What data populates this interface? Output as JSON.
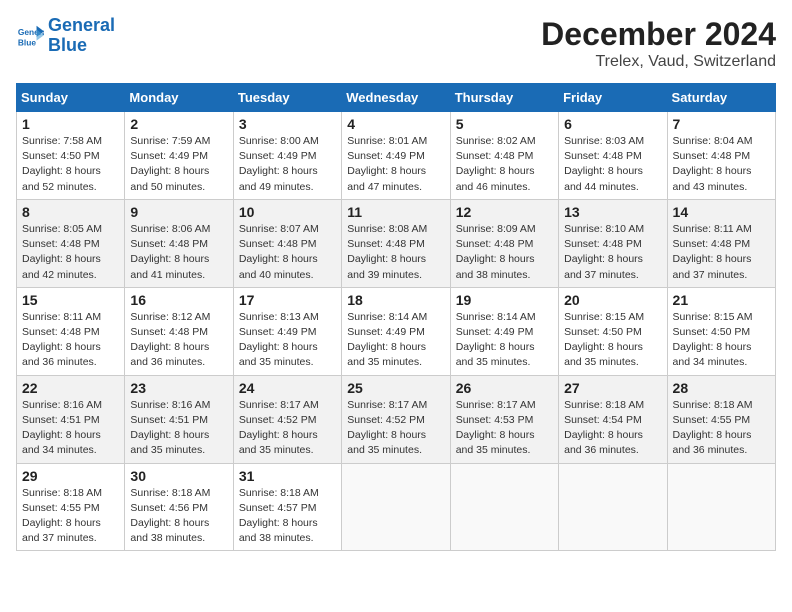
{
  "header": {
    "logo_line1": "General",
    "logo_line2": "Blue",
    "title": "December 2024",
    "subtitle": "Trelex, Vaud, Switzerland"
  },
  "columns": [
    "Sunday",
    "Monday",
    "Tuesday",
    "Wednesday",
    "Thursday",
    "Friday",
    "Saturday"
  ],
  "weeks": [
    [
      {
        "day": "1",
        "detail": "Sunrise: 7:58 AM\nSunset: 4:50 PM\nDaylight: 8 hours and 52 minutes."
      },
      {
        "day": "2",
        "detail": "Sunrise: 7:59 AM\nSunset: 4:49 PM\nDaylight: 8 hours and 50 minutes."
      },
      {
        "day": "3",
        "detail": "Sunrise: 8:00 AM\nSunset: 4:49 PM\nDaylight: 8 hours and 49 minutes."
      },
      {
        "day": "4",
        "detail": "Sunrise: 8:01 AM\nSunset: 4:49 PM\nDaylight: 8 hours and 47 minutes."
      },
      {
        "day": "5",
        "detail": "Sunrise: 8:02 AM\nSunset: 4:48 PM\nDaylight: 8 hours and 46 minutes."
      },
      {
        "day": "6",
        "detail": "Sunrise: 8:03 AM\nSunset: 4:48 PM\nDaylight: 8 hours and 44 minutes."
      },
      {
        "day": "7",
        "detail": "Sunrise: 8:04 AM\nSunset: 4:48 PM\nDaylight: 8 hours and 43 minutes."
      }
    ],
    [
      {
        "day": "8",
        "detail": "Sunrise: 8:05 AM\nSunset: 4:48 PM\nDaylight: 8 hours and 42 minutes."
      },
      {
        "day": "9",
        "detail": "Sunrise: 8:06 AM\nSunset: 4:48 PM\nDaylight: 8 hours and 41 minutes."
      },
      {
        "day": "10",
        "detail": "Sunrise: 8:07 AM\nSunset: 4:48 PM\nDaylight: 8 hours and 40 minutes."
      },
      {
        "day": "11",
        "detail": "Sunrise: 8:08 AM\nSunset: 4:48 PM\nDaylight: 8 hours and 39 minutes."
      },
      {
        "day": "12",
        "detail": "Sunrise: 8:09 AM\nSunset: 4:48 PM\nDaylight: 8 hours and 38 minutes."
      },
      {
        "day": "13",
        "detail": "Sunrise: 8:10 AM\nSunset: 4:48 PM\nDaylight: 8 hours and 37 minutes."
      },
      {
        "day": "14",
        "detail": "Sunrise: 8:11 AM\nSunset: 4:48 PM\nDaylight: 8 hours and 37 minutes."
      }
    ],
    [
      {
        "day": "15",
        "detail": "Sunrise: 8:11 AM\nSunset: 4:48 PM\nDaylight: 8 hours and 36 minutes."
      },
      {
        "day": "16",
        "detail": "Sunrise: 8:12 AM\nSunset: 4:48 PM\nDaylight: 8 hours and 36 minutes."
      },
      {
        "day": "17",
        "detail": "Sunrise: 8:13 AM\nSunset: 4:49 PM\nDaylight: 8 hours and 35 minutes."
      },
      {
        "day": "18",
        "detail": "Sunrise: 8:14 AM\nSunset: 4:49 PM\nDaylight: 8 hours and 35 minutes."
      },
      {
        "day": "19",
        "detail": "Sunrise: 8:14 AM\nSunset: 4:49 PM\nDaylight: 8 hours and 35 minutes."
      },
      {
        "day": "20",
        "detail": "Sunrise: 8:15 AM\nSunset: 4:50 PM\nDaylight: 8 hours and 35 minutes."
      },
      {
        "day": "21",
        "detail": "Sunrise: 8:15 AM\nSunset: 4:50 PM\nDaylight: 8 hours and 34 minutes."
      }
    ],
    [
      {
        "day": "22",
        "detail": "Sunrise: 8:16 AM\nSunset: 4:51 PM\nDaylight: 8 hours and 34 minutes."
      },
      {
        "day": "23",
        "detail": "Sunrise: 8:16 AM\nSunset: 4:51 PM\nDaylight: 8 hours and 35 minutes."
      },
      {
        "day": "24",
        "detail": "Sunrise: 8:17 AM\nSunset: 4:52 PM\nDaylight: 8 hours and 35 minutes."
      },
      {
        "day": "25",
        "detail": "Sunrise: 8:17 AM\nSunset: 4:52 PM\nDaylight: 8 hours and 35 minutes."
      },
      {
        "day": "26",
        "detail": "Sunrise: 8:17 AM\nSunset: 4:53 PM\nDaylight: 8 hours and 35 minutes."
      },
      {
        "day": "27",
        "detail": "Sunrise: 8:18 AM\nSunset: 4:54 PM\nDaylight: 8 hours and 36 minutes."
      },
      {
        "day": "28",
        "detail": "Sunrise: 8:18 AM\nSunset: 4:55 PM\nDaylight: 8 hours and 36 minutes."
      }
    ],
    [
      {
        "day": "29",
        "detail": "Sunrise: 8:18 AM\nSunset: 4:55 PM\nDaylight: 8 hours and 37 minutes."
      },
      {
        "day": "30",
        "detail": "Sunrise: 8:18 AM\nSunset: 4:56 PM\nDaylight: 8 hours and 38 minutes."
      },
      {
        "day": "31",
        "detail": "Sunrise: 8:18 AM\nSunset: 4:57 PM\nDaylight: 8 hours and 38 minutes."
      },
      null,
      null,
      null,
      null
    ]
  ]
}
